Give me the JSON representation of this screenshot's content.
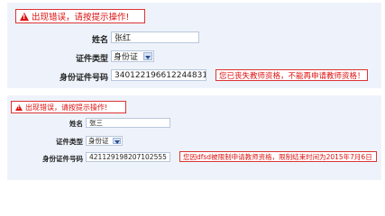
{
  "screen1": {
    "error_message": "出现错误，请按提示操作!",
    "name_label": "姓名",
    "name_value": "张红",
    "id_type_label": "证件类型",
    "id_type_selected": "身份证",
    "id_number_label": "身份证件号码",
    "id_number_value": "340122196612244831",
    "validation_message": "您已丧失教师资格，不能再申请教师资格！"
  },
  "screen2": {
    "error_message": "出现错误，请按提示操作!",
    "name_label": "姓名",
    "name_value": "张三",
    "id_type_label": "证件类型",
    "id_type_selected": "身份证",
    "id_number_label": "身份证件号码",
    "id_number_value": "421129198207102555",
    "validation_message": "您因dfsd被限制申请教师资格，限制结束时间为2015年7月6日"
  },
  "colors": {
    "panel_background": "#eef3fb",
    "error_red": "#d11111",
    "input_border": "#b9c7dc"
  },
  "icons": [
    "warning-icon",
    "chevron-down-icon"
  ]
}
